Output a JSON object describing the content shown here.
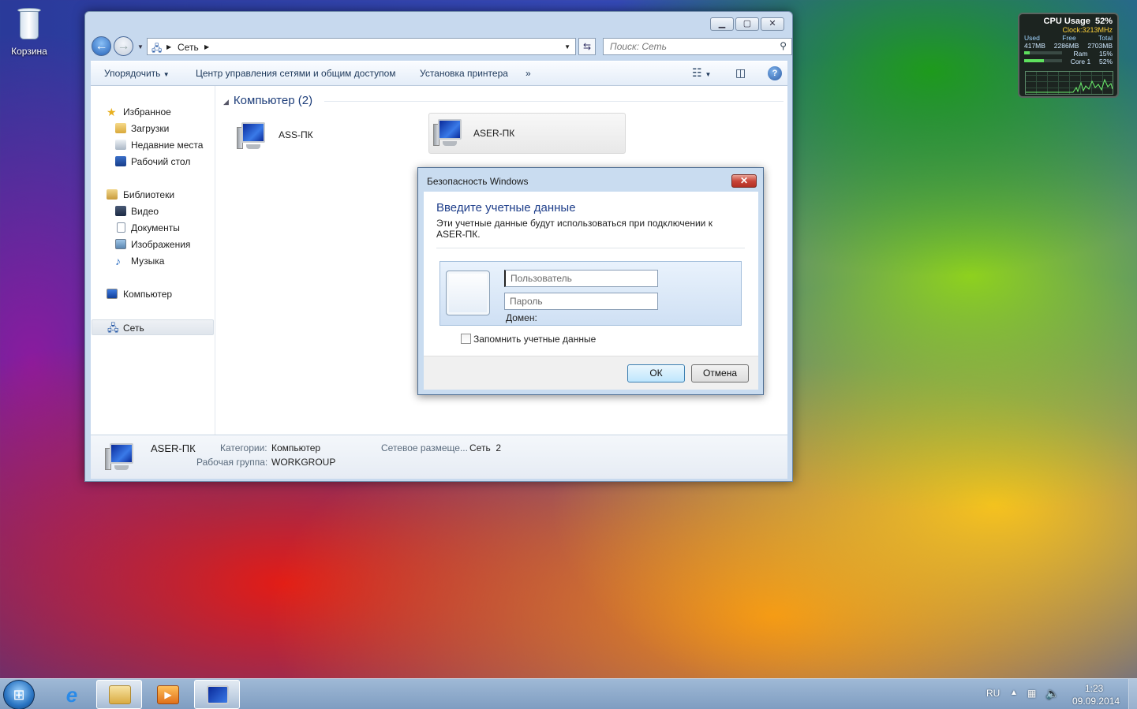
{
  "desktop": {
    "recycle_bin": "Корзина"
  },
  "gadget": {
    "title": "CPU Usage",
    "cpu_percent": "52%",
    "clock": "Clock:3213MHz",
    "headers": [
      "Used",
      "Free",
      "Total"
    ],
    "values": [
      "417MB",
      "2286MB",
      "2703MB"
    ],
    "ram_label": "Ram",
    "ram_value": "15%",
    "ram_fraction": 0.15,
    "core_label": "Core 1",
    "core_value": "52%",
    "core_fraction": 0.52
  },
  "explorer": {
    "address": {
      "crumb": "Сеть",
      "search_placeholder": "Поиск: Сеть"
    },
    "toolbar": {
      "organize": "Упорядочить",
      "network_center": "Центр управления сетями и общим доступом",
      "add_printer": "Установка принтера",
      "more": "»"
    },
    "nav": {
      "favorites": "Избранное",
      "downloads": "Загрузки",
      "recent": "Недавние места",
      "desktop": "Рабочий стол",
      "libraries": "Библиотеки",
      "video": "Видео",
      "documents": "Документы",
      "images": "Изображения",
      "music": "Музыка",
      "computer": "Компьютер",
      "network": "Сеть"
    },
    "group": {
      "title": "Компьютер (2)"
    },
    "computers": [
      {
        "name": "ASS-ПК"
      },
      {
        "name": "ASER-ПК"
      }
    ],
    "details": {
      "name": "ASER-ПК",
      "category_label": "Категории:",
      "category_value": "Компьютер",
      "workgroup_label": "Рабочая группа:",
      "workgroup_value": "WORKGROUP",
      "location_label": "Сетевое размеще...",
      "location_value": "Сеть  2"
    }
  },
  "dialog": {
    "title": "Безопасность Windows",
    "heading": "Введите учетные данные",
    "description": "Эти учетные данные будут использоваться при подключении к ASER-ПК.",
    "user_placeholder": "Пользователь",
    "password_placeholder": "Пароль",
    "domain_label": "Домен:",
    "remember_label": "Запомнить учетные данные",
    "ok": "ОК",
    "cancel": "Отмена"
  },
  "taskbar": {
    "language": "RU",
    "time": "1:23",
    "date": "09.09.2014"
  }
}
